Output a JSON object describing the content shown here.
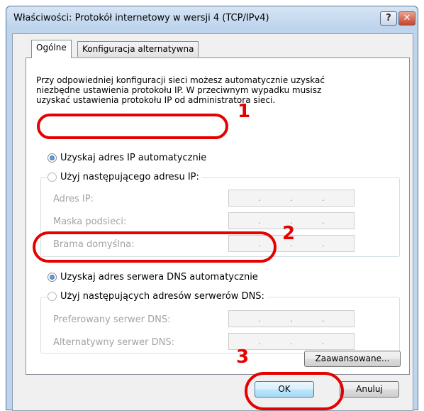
{
  "window": {
    "title": "Właściwości: Protokół internetowy w wersji 4 (TCP/IPv4)",
    "help_glyph": "?",
    "close_glyph": "✕"
  },
  "tabs": [
    {
      "label": "Ogólne",
      "active": true
    },
    {
      "label": "Konfiguracja alternatywna",
      "active": false
    }
  ],
  "description": "Przy odpowiedniej konfiguracji sieci możesz automatycznie uzyskać\nniezbędne ustawienia protokołu IP. W przeciwnym wypadku musisz\nuzyskać ustawienia protokołu IP od administratora sieci.",
  "ip": {
    "auto_label": "Uzyskaj adres IP automatycznie",
    "auto_checked": true,
    "manual_label": "Użyj następującego adresu IP:",
    "fields": [
      {
        "label": "Adres IP:",
        "value": ". . ."
      },
      {
        "label": "Maska podsieci:",
        "value": ". . ."
      },
      {
        "label": "Brama domyślna:",
        "value": ". . ."
      }
    ]
  },
  "dns": {
    "auto_label": "Uzyskaj adres serwera DNS automatycznie",
    "auto_checked": true,
    "manual_label": "Użyj następujących adresów serwerów DNS:",
    "fields": [
      {
        "label": "Preferowany serwer DNS:",
        "value": ". . ."
      },
      {
        "label": "Alternatywny serwer DNS:",
        "value": ". . ."
      }
    ]
  },
  "buttons": {
    "advanced": "Zaawansowane...",
    "ok": "OK",
    "cancel": "Anuluj"
  },
  "annotations": {
    "marker_1": "1",
    "marker_2": "2",
    "marker_3": "3",
    "color": "#e60000"
  }
}
